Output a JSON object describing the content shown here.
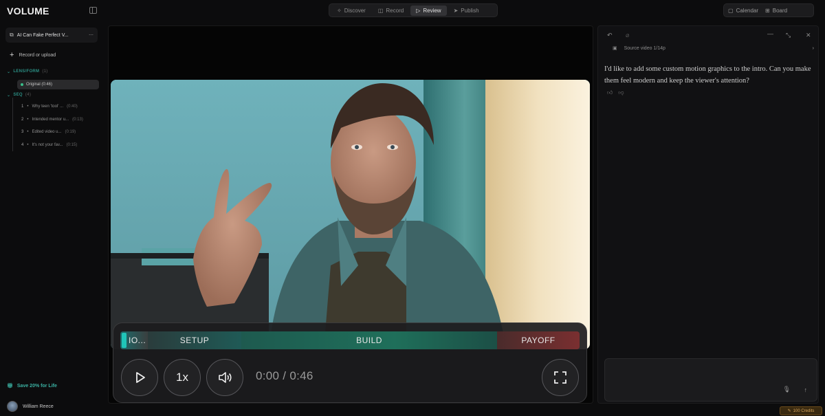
{
  "app": {
    "title": "VOLUME"
  },
  "nav": {
    "tabs": [
      {
        "label": "Discover",
        "icon": "sparkle-icon"
      },
      {
        "label": "Record",
        "icon": "camera-icon"
      },
      {
        "label": "Review",
        "icon": "play-icon",
        "active": true
      },
      {
        "label": "Publish",
        "icon": "send-icon"
      }
    ]
  },
  "top_right": {
    "calendar_label": "Calendar",
    "board_label": "Board"
  },
  "sidebar": {
    "project_title": "AI Can Fake Perfect V...",
    "record_label": "Record or upload",
    "lens_title": "LENS/FORM",
    "lens_count": "(1)",
    "lens_item": "Original (0:46)",
    "steps_title": "SEQ",
    "steps_count": "(4)",
    "steps": [
      {
        "num": "1",
        "label": "Why teen 'tool' ...",
        "dur": "(0:40)"
      },
      {
        "num": "2",
        "label": "Intended mentor u...",
        "dur": "(0:13)"
      },
      {
        "num": "3",
        "label": "Edited video u...",
        "dur": "(0:19)"
      },
      {
        "num": "4",
        "label": "It's not your fav...",
        "dur": "(0:15)"
      }
    ],
    "promo": "Save 20% for Life",
    "user_name": "William Reece"
  },
  "player": {
    "chapters": [
      "IO...",
      "SETUP",
      "BUILD",
      "PAYOFF"
    ],
    "speed": "1x",
    "time": "0:00 / 0:46"
  },
  "chat": {
    "source_label": "Source video 1/14p",
    "message": "I'd like to add some custom motion graphics to the intro. Can you make them feel modern and keep the viewer's attention?"
  },
  "credits": "100 Credits"
}
